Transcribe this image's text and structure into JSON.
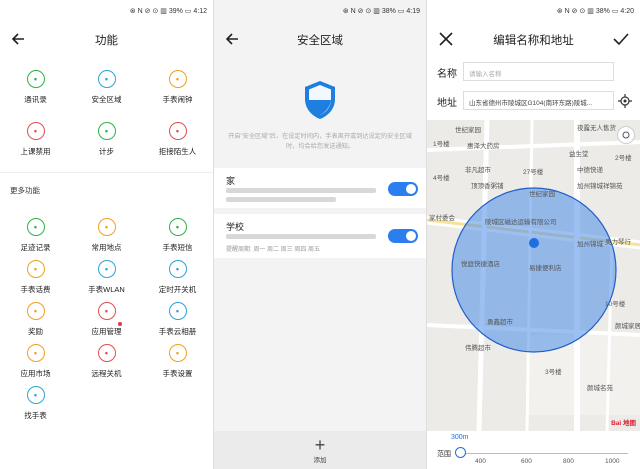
{
  "status": {
    "left_icons": "✉ ✉ ⊞ ⊞",
    "right_p1": "⊛ N ⊘ ⊙ ▥ 39% ▭ 4:12",
    "right_p2": "⊛ N ⊘ ⊙ ▥ 38% ▭ 4:19",
    "right_p3": "⊛ N ⊘ ⊙ ▥ 38% ▭ 4:20"
  },
  "panel1": {
    "title": "功能",
    "more_label": "更多功能",
    "top_items": [
      {
        "label": "通讯录",
        "icon": "person-icon",
        "color": "#2db24a"
      },
      {
        "label": "安全区域",
        "icon": "shield-icon",
        "color": "#2aa5d8"
      },
      {
        "label": "手表闹钟",
        "icon": "alarm-icon",
        "color": "#f0a020"
      },
      {
        "label": "上课禁用",
        "icon": "bag-icon",
        "color": "#e05050"
      },
      {
        "label": "计步",
        "icon": "shoe-icon",
        "color": "#2db24a"
      },
      {
        "label": "拒接陌生人",
        "icon": "phone-block-icon",
        "color": "#e05050"
      }
    ],
    "more_items": [
      {
        "label": "足迹记录",
        "icon": "location-icon",
        "color": "#2db24a"
      },
      {
        "label": "常用地点",
        "icon": "place-icon",
        "color": "#f0a020"
      },
      {
        "label": "手表短信",
        "icon": "message-icon",
        "color": "#2db24a"
      },
      {
        "label": "手表话费",
        "icon": "phone-bill-icon",
        "color": "#f0a020"
      },
      {
        "label": "手表WLAN",
        "icon": "wifi-icon",
        "color": "#2aa5d8"
      },
      {
        "label": "定时开关机",
        "icon": "clock-icon",
        "color": "#2aa5d8"
      },
      {
        "label": "奖励",
        "icon": "medal-icon",
        "color": "#f0a020"
      },
      {
        "label": "应用管理",
        "icon": "app-icon",
        "color": "#e05050"
      },
      {
        "label": "手表云相册",
        "icon": "photo-icon",
        "color": "#2aa5d8"
      },
      {
        "label": "应用市场",
        "icon": "market-icon",
        "color": "#f0a020"
      },
      {
        "label": "远程关机",
        "icon": "power-icon",
        "color": "#e05050"
      },
      {
        "label": "手表设置",
        "icon": "settings-icon",
        "color": "#f0a020"
      },
      {
        "label": "找手表",
        "icon": "find-watch-icon",
        "color": "#2aa5d8"
      }
    ]
  },
  "panel2": {
    "title": "安全区域",
    "description": "开启\"安全区域\"后，在设定时间内，手表离开或到达设定的安全区域时，均会给您发送通知。",
    "zones": [
      {
        "name": "家",
        "schedule": ""
      },
      {
        "name": "学校",
        "schedule": "提醒周期: 周一 周二 周三 周四 周五"
      }
    ],
    "add_label": "添加"
  },
  "panel3": {
    "title": "编辑名称和地址",
    "name_label": "名称",
    "name_placeholder": "请输入名称",
    "address_label": "地址",
    "address_value": "山东省德州市陵城区G104(南环东路)陵城...",
    "map_labels": [
      "世纪家园",
      "夜露无人售货",
      "惠泽大药房",
      "益生堂",
      "非凡超市",
      "中德快递",
      "顶顶香粥铺",
      "世纪家园",
      "加州锦城祥锦苑",
      "家村委会",
      "陵城区磁达运输有限公司",
      "加州锦城",
      "奥力琴行",
      "悦庭快捷酒店",
      "易捷便利店",
      "勇鑫超市",
      "颜城家居",
      "伟腾超市",
      "颜城名苑",
      "27号楼",
      "1号楼",
      "2号楼",
      "4号楼",
      "10号楼",
      "3号楼"
    ],
    "map_logo": "Bai 地图",
    "range_label": "范围",
    "range_value": "300m",
    "range_ticks": [
      "400",
      "600",
      "800",
      "1000"
    ]
  }
}
